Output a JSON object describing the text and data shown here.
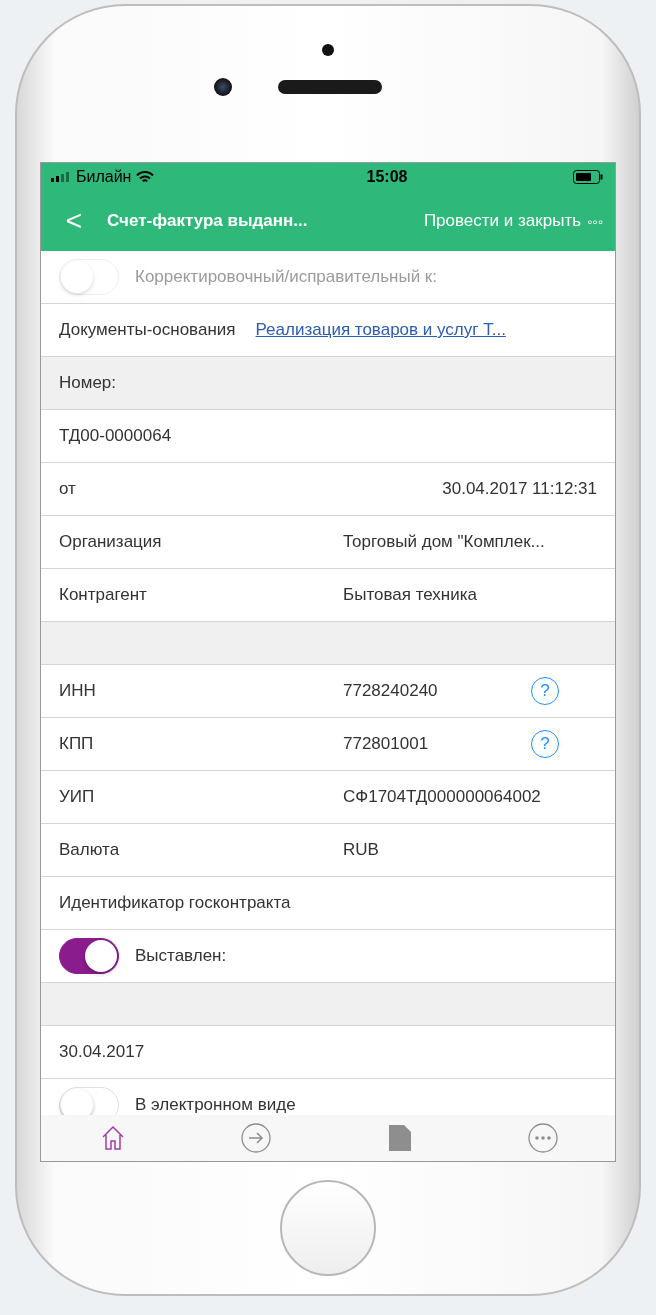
{
  "status_bar": {
    "carrier": "Билайн",
    "time": "15:08"
  },
  "nav_bar": {
    "back": "<",
    "title": "Счет-фактура выданн...",
    "action": "Провести и закрыть",
    "more": "◦◦◦"
  },
  "rows": [
    {
      "kind": "toggle",
      "label": "Корректировочный/исправительный к:",
      "on": false,
      "disabled": true
    },
    {
      "kind": "link",
      "label": "Документы-основания",
      "value": "Реализация товаров и услуг Т..."
    },
    {
      "kind": "header",
      "label": "Номер:"
    },
    {
      "kind": "text",
      "value": "ТД00-0000064"
    },
    {
      "kind": "datetime",
      "label": "от",
      "value": "30.04.2017 11:12:31"
    },
    {
      "kind": "field",
      "label": "Организация",
      "value": "Торговый дом \"Комплек..."
    },
    {
      "kind": "field",
      "label": "Контрагент",
      "value": "Бытовая техника"
    },
    {
      "kind": "spacer"
    },
    {
      "kind": "field",
      "label": "ИНН",
      "value": "7728240240",
      "help": "?"
    },
    {
      "kind": "field",
      "label": "КПП",
      "value": "772801001",
      "help": "?"
    },
    {
      "kind": "field",
      "label": "УИП",
      "value": "СФ1704ТД000000064002"
    },
    {
      "kind": "field",
      "label": "Валюта",
      "value": "RUB"
    },
    {
      "kind": "text",
      "value": "Идентификатор госконтракта"
    },
    {
      "kind": "toggle",
      "label": "Выставлен:",
      "on": true,
      "disabled": false
    },
    {
      "kind": "spacer"
    },
    {
      "kind": "text",
      "value": "30.04.2017"
    },
    {
      "kind": "toggle",
      "label": "В электронном виде",
      "on": false,
      "disabled": false
    }
  ],
  "tab_bar": [
    {
      "selected": true
    },
    {
      "selected": false
    },
    {
      "selected": false
    },
    {
      "selected": false
    }
  ]
}
